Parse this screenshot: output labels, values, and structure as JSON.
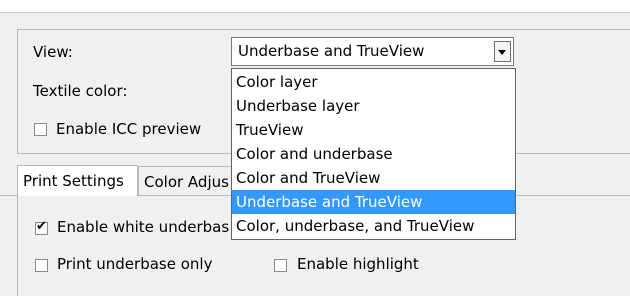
{
  "view_label": "View:",
  "textile_color_label": "Textile color:",
  "enable_icc_preview": {
    "label": "Enable ICC preview",
    "checked": false
  },
  "view_select": {
    "value": "Underbase and TrueView",
    "options": [
      "Color layer",
      "Underbase layer",
      "TrueView",
      "Color and underbase",
      "Color and TrueView",
      "Underbase and TrueView",
      "Color, underbase, and TrueView"
    ],
    "selected_index": 5
  },
  "tabs": [
    "Print Settings",
    "Color Adjus"
  ],
  "enable_white_underbase": {
    "label": "Enable white underbas",
    "checked": true
  },
  "print_underbase_only": {
    "label": "Print underbase only",
    "checked": false
  },
  "enable_highlight": {
    "label": "Enable highlight",
    "checked": false
  },
  "colors": {
    "highlight": "#3399ff",
    "background": "#f0f0f0"
  }
}
